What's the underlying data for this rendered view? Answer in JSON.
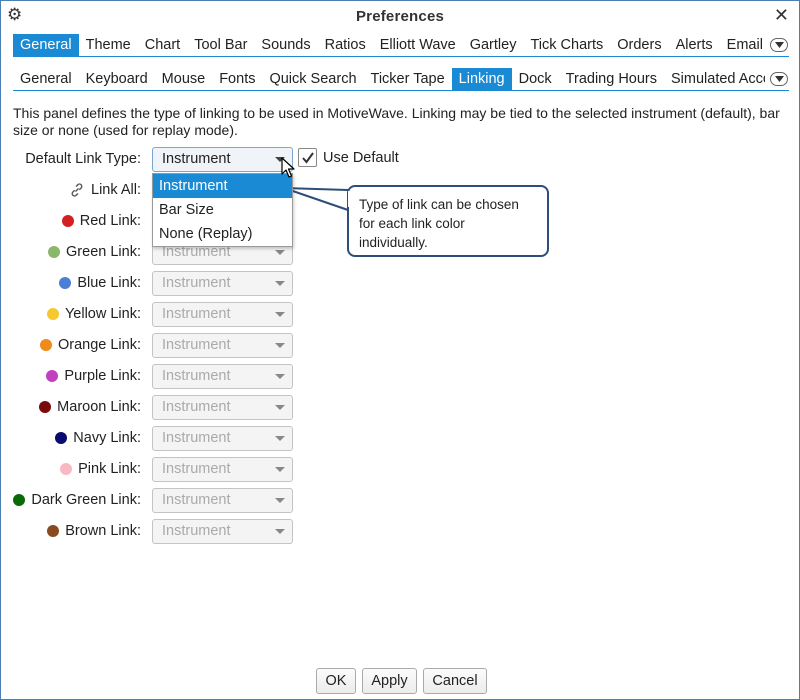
{
  "window": {
    "title": "Preferences"
  },
  "tabs_primary": [
    {
      "label": "General",
      "active": true
    },
    {
      "label": "Theme"
    },
    {
      "label": "Chart"
    },
    {
      "label": "Tool Bar"
    },
    {
      "label": "Sounds"
    },
    {
      "label": "Ratios"
    },
    {
      "label": "Elliott Wave"
    },
    {
      "label": "Gartley"
    },
    {
      "label": "Tick Charts"
    },
    {
      "label": "Orders"
    },
    {
      "label": "Alerts"
    },
    {
      "label": "Email"
    }
  ],
  "tabs_secondary": [
    {
      "label": "General"
    },
    {
      "label": "Keyboard"
    },
    {
      "label": "Mouse"
    },
    {
      "label": "Fonts"
    },
    {
      "label": "Quick Search"
    },
    {
      "label": "Ticker Tape"
    },
    {
      "label": "Linking",
      "active": true
    },
    {
      "label": "Dock"
    },
    {
      "label": "Trading Hours"
    },
    {
      "label": "Simulated Accou"
    }
  ],
  "description": "This panel defines the type of linking to be used in MotiveWave.  Linking may be tied to the selected instrument (default), bar size or none (used for replay mode).",
  "default_link": {
    "label": "Default Link Type:",
    "value": "Instrument"
  },
  "use_default": {
    "label": "Use Default",
    "checked": true
  },
  "link_all": {
    "label": "Link All:"
  },
  "links": [
    {
      "label": "Red Link:",
      "color": "#d42020",
      "value": "Instrument"
    },
    {
      "label": "Green Link:",
      "color": "#8ab86a",
      "value": "Instrument"
    },
    {
      "label": "Blue Link:",
      "color": "#4a7fd4",
      "value": "Instrument"
    },
    {
      "label": "Yellow Link:",
      "color": "#f5c830",
      "value": "Instrument"
    },
    {
      "label": "Orange Link:",
      "color": "#f08a1a",
      "value": "Instrument"
    },
    {
      "label": "Purple Link:",
      "color": "#c040c0",
      "value": "Instrument"
    },
    {
      "label": "Maroon Link:",
      "color": "#7a0a0a",
      "value": "Instrument"
    },
    {
      "label": "Navy Link:",
      "color": "#0a0a70",
      "value": "Instrument"
    },
    {
      "label": "Pink Link:",
      "color": "#f8b8c4",
      "value": "Instrument"
    },
    {
      "label": "Dark Green Link:",
      "color": "#0a6a0a",
      "value": "Instrument"
    },
    {
      "label": "Brown Link:",
      "color": "#8a4a20",
      "value": "Instrument"
    }
  ],
  "dropdown_options": [
    "Instrument",
    "Bar Size",
    "None (Replay)"
  ],
  "callout": {
    "text": "Type of link can be chosen for each link color individually."
  },
  "buttons": {
    "ok": "OK",
    "apply": "Apply",
    "cancel": "Cancel"
  },
  "colors": {
    "accent": "#1a8ad4",
    "callout_border": "#2c4e78"
  }
}
